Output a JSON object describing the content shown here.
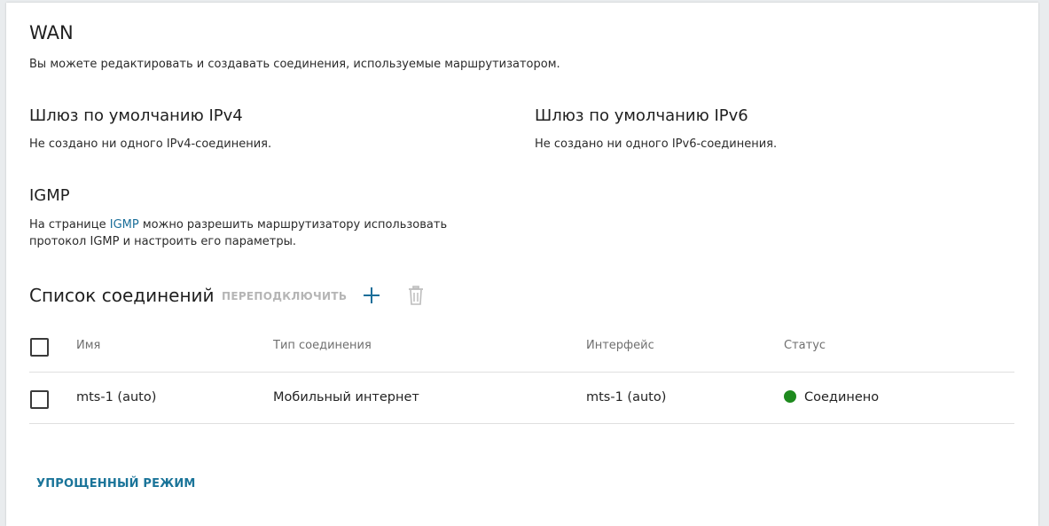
{
  "page": {
    "title": "WAN",
    "description": "Вы можете редактировать и создавать соединения, используемые маршрутизатором."
  },
  "gateway_ipv4": {
    "title": "Шлюз по умолчанию IPv4",
    "text": "Не создано ни одного IPv4-соединения."
  },
  "gateway_ipv6": {
    "title": "Шлюз по умолчанию IPv6",
    "text": "Не создано ни одного IPv6-соединения."
  },
  "igmp": {
    "title": "IGMP",
    "text_before": "На странице ",
    "link": "IGMP",
    "text_after_line1": " можно разрешить маршрутизатору использовать",
    "text_line2": "протокол IGMP и настроить его параметры."
  },
  "connections": {
    "title": "Список соединений",
    "reconnect_label": "ПЕРЕПОДКЛЮЧИТЬ",
    "add_icon": "plus-icon",
    "delete_icon": "trash-icon",
    "columns": [
      "Имя",
      "Тип соединения",
      "Интерфейс",
      "Статус"
    ],
    "rows": [
      {
        "name": "mts-1 (auto)",
        "type": "Мобильный интернет",
        "interface": "mts-1 (auto)",
        "status": "Соединено"
      }
    ]
  },
  "footer": {
    "simple_mode_label": "УПРОЩЕННЫЙ РЕЖИМ"
  },
  "colors": {
    "accent": "#1a6e99",
    "status_connected": "#1e8a1e"
  }
}
